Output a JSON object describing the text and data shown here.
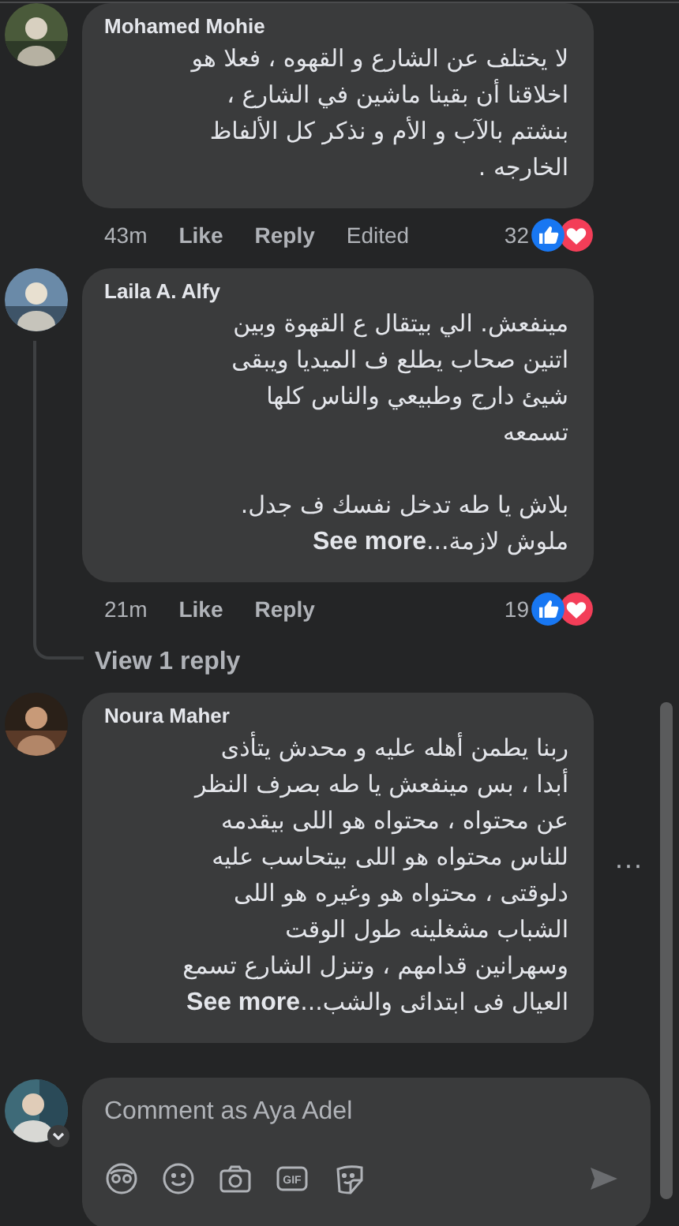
{
  "comments": [
    {
      "author": "Mohamed Mohie",
      "paragraphs": [
        [
          "لا يختلف عن الشارع و القهوه ، فعلا هو",
          "اخلاقنا أن بقينا ماشين في الشارع ،",
          "بنشتم بالآب و الأم و نذكر كل الألفاظ",
          "الخارجه ."
        ]
      ],
      "time": "43m",
      "like": "Like",
      "reply": "Reply",
      "edited": "Edited",
      "reaction_count": "32",
      "reactions": [
        {
          "kind": "like"
        },
        {
          "kind": "love"
        }
      ]
    },
    {
      "author": "Laila A. Alfy",
      "paragraphs": [
        [
          "مينفعش. الي بيتقال ع القهوة وبين",
          "اتنين صحاب يطلع ف الميديا ويبقى",
          "شيئ دارج وطبيعي والناس كلها",
          "تسمعه"
        ],
        [
          "بلاش يا طه تدخل نفسك ف جدل.",
          "ملوش لازمة..."
        ]
      ],
      "see_more": "See more",
      "time": "21m",
      "like": "Like",
      "reply": "Reply",
      "reaction_count": "19",
      "reactions": [
        {
          "kind": "like"
        },
        {
          "kind": "love"
        }
      ],
      "view_replies": "View 1 reply"
    },
    {
      "author": "Noura Maher",
      "paragraphs": [
        [
          "ربنا يطمن أهله عليه و محدش يتأذى",
          "أبدا ، بس مينفعش يا طه بصرف النظر",
          "عن محتواه ، محتواه هو اللى بيقدمه",
          "للناس محتواه هو اللى بيتحاسب عليه",
          "دلوقتى ، محتواه هو وغيره هو اللى",
          "الشباب مشغلينه طول الوقت",
          "وسهرانين قدامهم ، وتنزل الشارع تسمع",
          "العيال فى ابتدائى والشب..."
        ]
      ],
      "see_more": "See more",
      "more_menu": "···"
    }
  ],
  "composer": {
    "placeholder": "Comment as Aya Adel",
    "tools": [
      {
        "kind": "avatar"
      },
      {
        "kind": "emoji"
      },
      {
        "kind": "camera"
      },
      {
        "kind": "gif",
        "label": "GIF"
      },
      {
        "kind": "sticker"
      }
    ]
  }
}
